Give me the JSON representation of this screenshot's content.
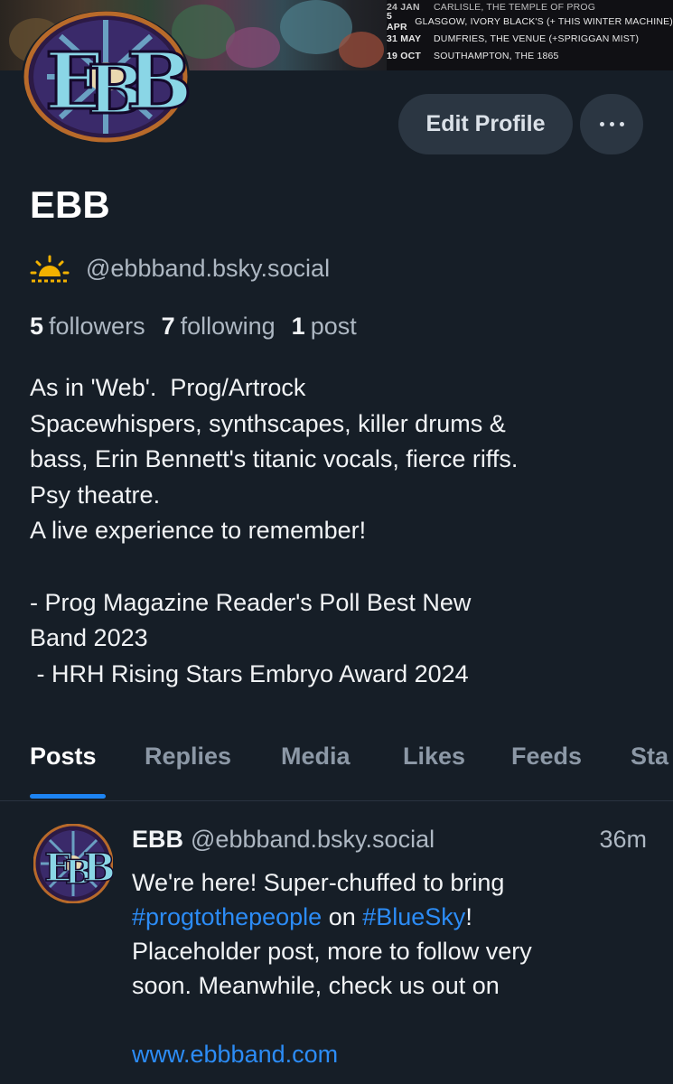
{
  "banner": {
    "gigs": [
      {
        "date": "5 APR",
        "place": "GLASGOW, IVORY BLACK'S (+ THIS WINTER MACHINE)"
      },
      {
        "date": "31 MAY",
        "place": "DUMFRIES, THE VENUE (+SPRIGGAN MIST)"
      },
      {
        "date": "19 OCT",
        "place": "SOUTHAMPTON, THE 1865"
      }
    ]
  },
  "avatar": {
    "logo_text": "EBB"
  },
  "actions": {
    "edit_profile": "Edit Profile",
    "more_icon": "ellipsis-icon"
  },
  "profile": {
    "display_name": "EBB",
    "handle": "@ebbband.bsky.social",
    "status_icon": "sunrise-icon",
    "stats": {
      "followers_count": "5",
      "followers_label": "followers",
      "following_count": "7",
      "following_label": "following",
      "posts_count": "1",
      "posts_label": "post"
    },
    "bio_lines": [
      "As in 'Web'.  Prog/Artrock",
      "Spacewhispers, synthscapes, killer drums &",
      "bass, Erin Bennett's titanic vocals, fierce riffs.",
      "Psy theatre.",
      "A live experience to remember!",
      "",
      "- Prog Magazine Reader's Poll Best New",
      "Band 2023",
      " - HRH Rising Stars Embryo Award 2024"
    ]
  },
  "tabs": [
    {
      "label": "Posts",
      "active": true
    },
    {
      "label": "Replies"
    },
    {
      "label": "Media"
    },
    {
      "label": "Likes"
    },
    {
      "label": "Feeds"
    },
    {
      "label": "Sta"
    }
  ],
  "post": {
    "name": "EBB",
    "handle": "@ebbband.bsky.social",
    "time": "36m",
    "line1": "We're here! Super-chuffed to bring",
    "hashtag1": "#progtothepeople",
    "on_text": " on ",
    "hashtag2": "#BlueSky",
    "excl": "!",
    "line3": "Placeholder post, more to follow very",
    "line4": "soon. Meanwhile, check us out on",
    "link": "www.ebbband.com"
  },
  "colors": {
    "background": "#161e27",
    "accent": "#1d84f3",
    "link": "#2c8cf6",
    "button": "#2b3642"
  }
}
